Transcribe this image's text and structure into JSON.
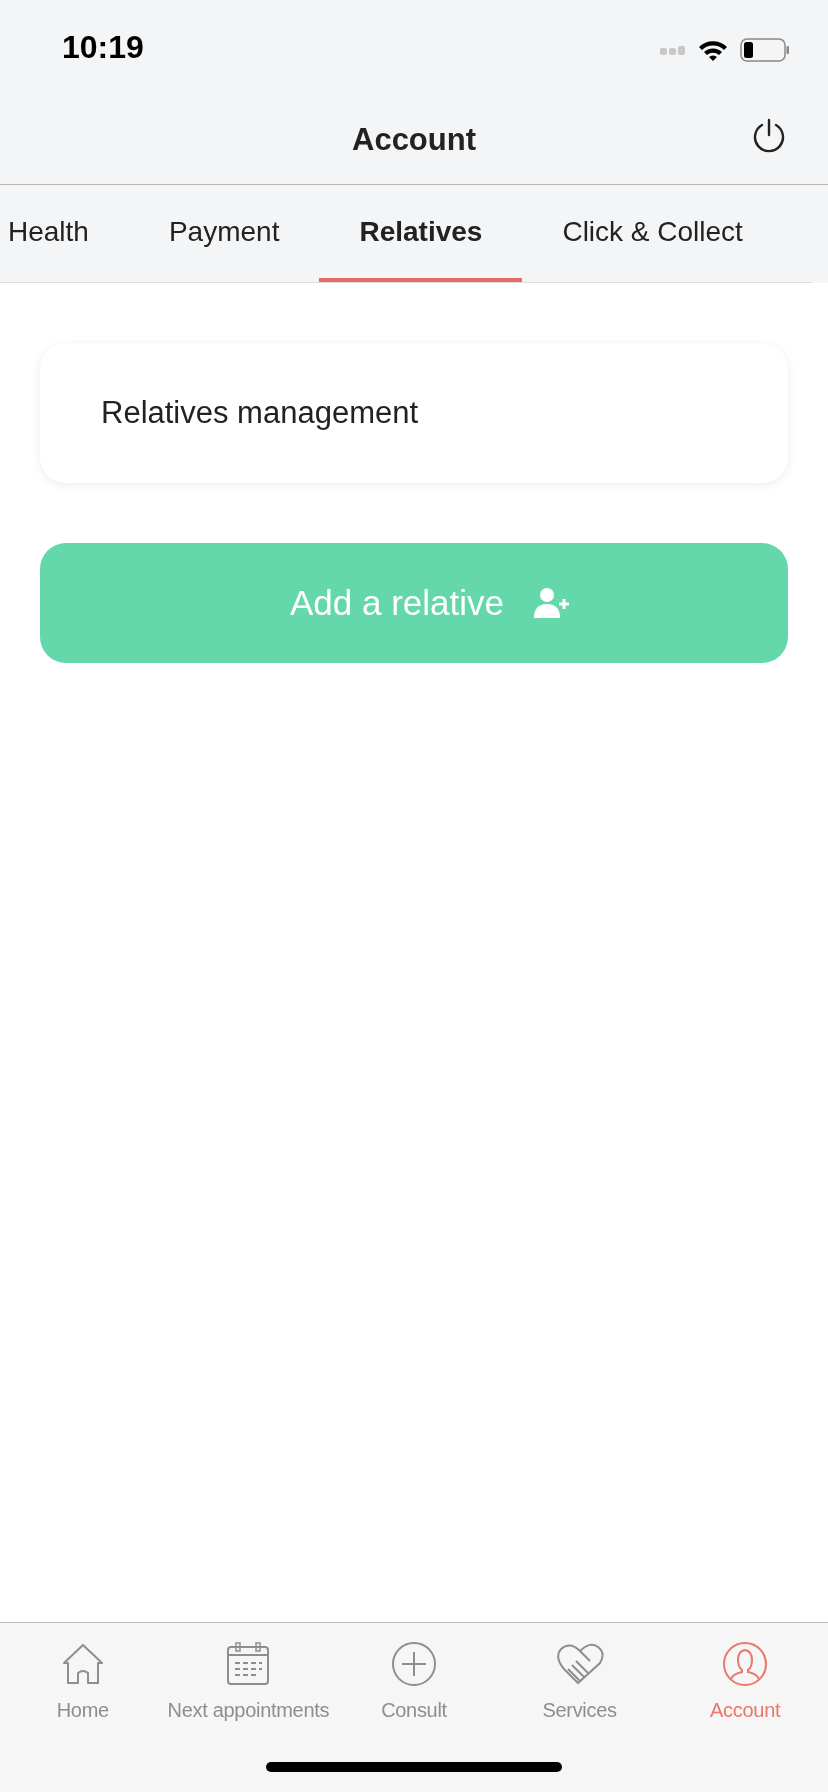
{
  "status_bar": {
    "time": "10:19"
  },
  "header": {
    "title": "Account"
  },
  "tabs": [
    {
      "label": "Health",
      "selected": false
    },
    {
      "label": "Payment",
      "selected": false
    },
    {
      "label": "Relatives",
      "selected": true
    },
    {
      "label": "Click & Collect",
      "selected": false
    }
  ],
  "card": {
    "title": "Relatives management"
  },
  "add_button": {
    "label": "Add a relative"
  },
  "bottom_nav": [
    {
      "label": "Home",
      "selected": false
    },
    {
      "label": "Next appointments",
      "selected": false
    },
    {
      "label": "Consult",
      "selected": false
    },
    {
      "label": "Services",
      "selected": false
    },
    {
      "label": "Account",
      "selected": true
    }
  ]
}
